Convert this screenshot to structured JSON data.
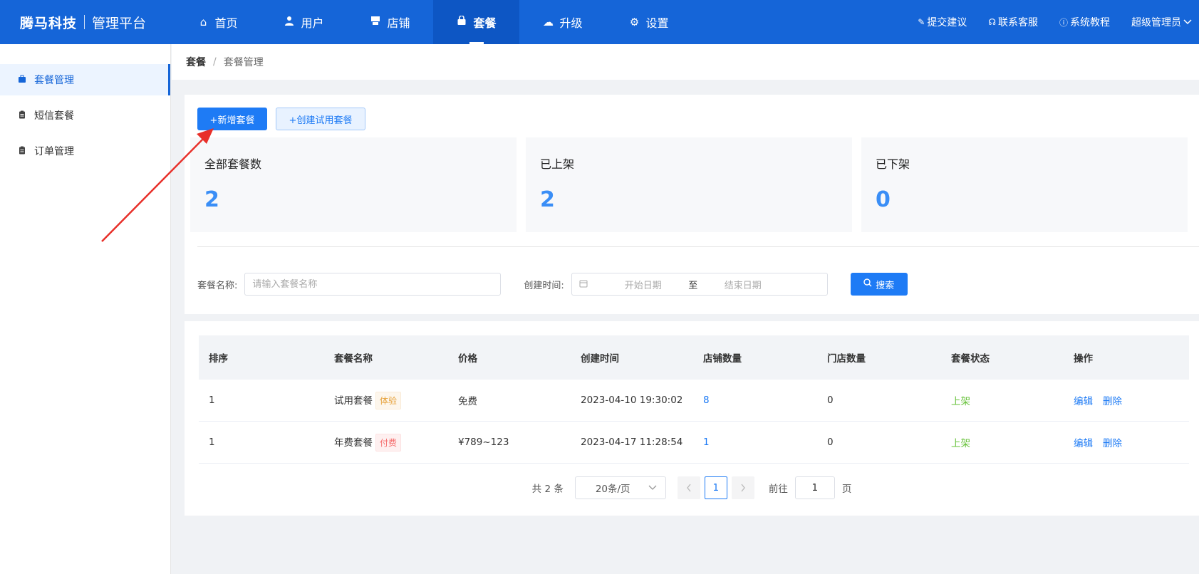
{
  "brand": {
    "name": "腾马科技",
    "subtitle": "管理平台"
  },
  "nav": [
    {
      "label": "首页",
      "icon": "home-icon",
      "glyph": "⌂"
    },
    {
      "label": "用户",
      "icon": "user-icon",
      "glyph": "👤"
    },
    {
      "label": "店铺",
      "icon": "shop-icon",
      "glyph": "▬"
    },
    {
      "label": "套餐",
      "icon": "bag-icon",
      "glyph": "▲",
      "active": true
    },
    {
      "label": "升级",
      "icon": "cloud-upload-icon",
      "glyph": "☁"
    },
    {
      "label": "设置",
      "icon": "gear-icon",
      "glyph": "⚙"
    }
  ],
  "top_right": {
    "feedback": "提交建议",
    "support": "联系客服",
    "tutorial": "系统教程",
    "user": "超级管理员"
  },
  "sidebar": {
    "items": [
      {
        "label": "套餐管理",
        "active": true
      },
      {
        "label": "短信套餐"
      },
      {
        "label": "订单管理"
      }
    ]
  },
  "breadcrumb": {
    "root": "套餐",
    "current": "套餐管理"
  },
  "actions": {
    "add": "+新增套餐",
    "trial": "+创建试用套餐"
  },
  "stats": [
    {
      "label": "全部套餐数",
      "value": "2"
    },
    {
      "label": "已上架",
      "value": "2"
    },
    {
      "label": "已下架",
      "value": "0"
    }
  ],
  "filter": {
    "name_label": "套餐名称:",
    "name_placeholder": "请输入套餐名称",
    "date_label": "创建时间:",
    "start_placeholder": "开始日期",
    "to": "至",
    "end_placeholder": "结束日期",
    "search": "搜索"
  },
  "table": {
    "columns": [
      "排序",
      "套餐名称",
      "价格",
      "创建时间",
      "店铺数量",
      "门店数量",
      "套餐状态",
      "操作"
    ],
    "rows": [
      {
        "order": "1",
        "name": "试用套餐",
        "tag": "体验",
        "price": "免费",
        "created": "2023-04-10 19:30:02",
        "shops": "8",
        "stores": "0",
        "status": "上架",
        "edit": "编辑",
        "delete": "删除"
      },
      {
        "order": "1",
        "name": "年费套餐",
        "tag": "付费",
        "price": "¥789~123",
        "created": "2023-04-17 11:28:54",
        "shops": "1",
        "stores": "0",
        "status": "上架",
        "edit": "编辑",
        "delete": "删除"
      }
    ]
  },
  "pager": {
    "total": "共 2 条",
    "page_size": "20条/页",
    "current": "1",
    "goto_label": "前往",
    "goto_value": "1",
    "page_suffix": "页"
  },
  "colors": {
    "primary": "#1565d8",
    "accent": "#1e7bf5",
    "annotation": "#e8302a"
  }
}
